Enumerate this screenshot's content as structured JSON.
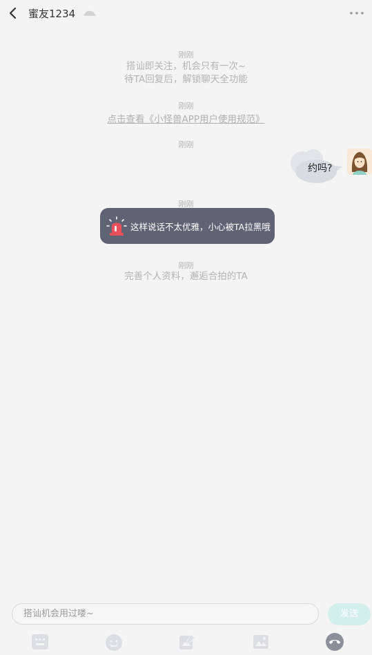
{
  "header": {
    "title": "蜜友1234",
    "back_icon": "chevron-left-icon",
    "status_icon": "hat-icon",
    "more_icon": "more-dots-icon"
  },
  "messages": {
    "ts1": "刚刚",
    "notice_line1": "搭讪即关注，机会只有一次~",
    "notice_line2": "待TA回复后，解锁聊天全功能",
    "ts2": "刚刚",
    "rules_link": "点击查看《小怪兽APP用户使用规范》",
    "ts3": "刚刚",
    "bubble_text": "约吗?",
    "ts4": "刚刚",
    "warning_text": "这样说话不太优雅，小心被TA拉黑哦",
    "ts5": "刚刚",
    "profile_tip": "完善个人资料，邂逅合拍的TA"
  },
  "input": {
    "placeholder": "搭讪机会用过喽~",
    "value": "",
    "send_label": "发送"
  },
  "toolbar": {
    "icons": [
      "keyboard-icon",
      "emoji-icon",
      "edit-card-icon",
      "image-icon",
      "phone-icon"
    ]
  },
  "colors": {
    "background": "#f4f4f4",
    "warning_bg": "#5f6474",
    "alarm_red": "#e8505b",
    "send_bg": "#d3efec",
    "phone_icon": "#8a8f9a"
  }
}
